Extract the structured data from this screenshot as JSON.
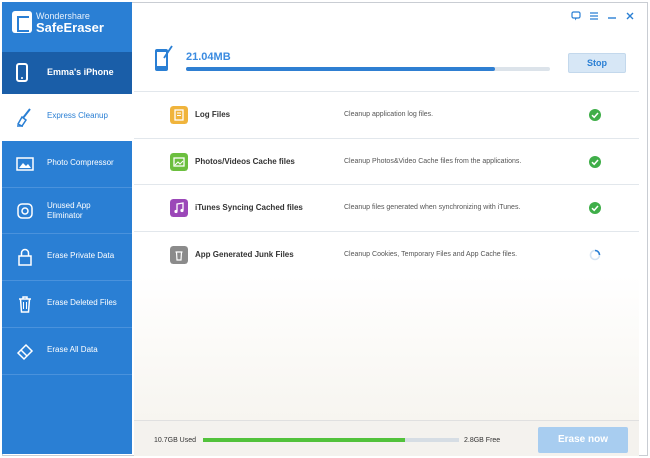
{
  "app": {
    "brand_small": "Wondershare",
    "brand_name": "SafeEraser"
  },
  "window_controls": {
    "feedback_icon": "speech-bubble-icon",
    "menu_icon": "menu-icon",
    "minimize_icon": "minimize-icon",
    "close_icon": "close-icon"
  },
  "device": {
    "name": "Emma's iPhone"
  },
  "sidebar": {
    "items": [
      {
        "label": "Express Cleanup",
        "icon": "broom-icon",
        "active": true
      },
      {
        "label": "Photo Compressor",
        "icon": "image-icon",
        "active": false
      },
      {
        "label": "Unused App Eliminator",
        "icon": "app-icon",
        "active": false
      },
      {
        "label": "Erase Private Data",
        "icon": "lock-icon",
        "active": false
      },
      {
        "label": "Erase Deleted Files",
        "icon": "trash-icon",
        "active": false
      },
      {
        "label": "Erase All Data",
        "icon": "eraser-icon",
        "active": false
      }
    ]
  },
  "header": {
    "size": "21.04MB",
    "progress_fraction": 0.85,
    "stop_label": "Stop"
  },
  "cleanup_items": [
    {
      "name": "Log Files",
      "desc": "Cleanup application log files.",
      "icon_color": "#f0b43c",
      "status": "done"
    },
    {
      "name": "Photos/Videos Cache files",
      "desc": "Cleanup Photos&Video Cache files from the applications.",
      "icon_color": "#6cbf3f",
      "status": "done"
    },
    {
      "name": "iTunes Syncing Cached files",
      "desc": "Cleanup files generated when synchronizing with iTunes.",
      "icon_color": "#9b47b8",
      "status": "done"
    },
    {
      "name": "App Generated Junk Files",
      "desc": "Cleanup Cookies, Temporary Files and App Cache files.",
      "icon_color": "#8b8b8b",
      "status": "loading"
    }
  ],
  "footer": {
    "used": "10.7GB Used",
    "free": "2.8GB Free",
    "used_fraction": 0.79,
    "erase_label": "Erase now"
  },
  "colors": {
    "accent": "#2a7fd4",
    "success": "#3fae49",
    "storage": "#52c23b"
  }
}
